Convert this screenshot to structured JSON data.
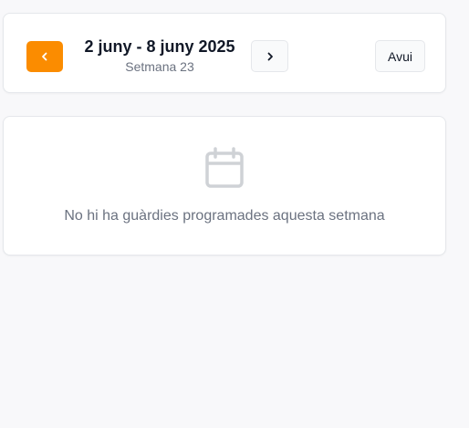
{
  "week_nav": {
    "date_range": "2 juny - 8 juny 2025",
    "week_label": "Setmana 23",
    "today_label": "Avui",
    "prev_icon": "chevron-left-icon",
    "next_icon": "chevron-right-icon"
  },
  "empty_state": {
    "icon": "calendar-icon",
    "message": "No hi ha guàrdies programades aquesta setmana"
  },
  "colors": {
    "accent": "#fb8c00",
    "background": "#f8f8fa",
    "card": "#ffffff",
    "muted_text": "#6b7280",
    "icon_gray": "#cfd2d6"
  }
}
